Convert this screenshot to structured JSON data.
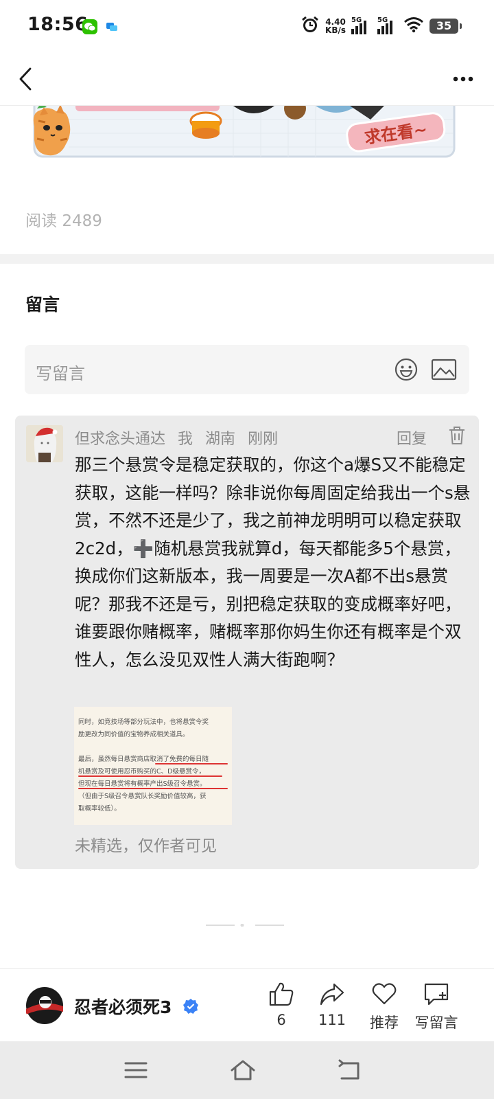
{
  "status_bar": {
    "time": "18:56",
    "net_speed_value": "4.40",
    "net_speed_unit": "KB/s",
    "sim1_label": "5G",
    "sim2_label": "5G",
    "battery_level": "35",
    "icons": [
      "wechat-icon",
      "app-notification-icon",
      "alarm-icon",
      "signal-icon",
      "signal-icon",
      "wifi-icon",
      "battery-icon"
    ]
  },
  "nav": {
    "back_icon": "chevron-left-icon",
    "more_icon": "more-dots-icon"
  },
  "banner": {
    "text": "求在看~"
  },
  "article": {
    "read_label": "阅读",
    "read_count": "2489"
  },
  "comments": {
    "title": "留言",
    "input_placeholder": "写留言",
    "items": [
      {
        "author": "但求念头通达",
        "self_tag": "我",
        "location": "湖南",
        "time": "刚刚",
        "reply_label": "回复",
        "text": "那三个悬赏令是稳定获取的，你这个a爆S又不能稳定获取，这能一样吗？除非说你每周固定给我出一个s悬赏，不然不还是少了，我之前神龙明明可以稳定获取2c2d，➕随机悬赏我就算d，每天都能多5个悬赏，换成你们这新版本，我一周要是一次A都不出s悬赏呢？那我不还是亏，别把稳定获取的变成概率好吧，谁要跟你赌概率，赌概率那你妈生你还有概率是个双性人，怎么没见双性人满大街跑啊？",
        "image_lines": [
          "同时，如竞技场等部分玩法中，也将悬赏令奖",
          "励更改为同价值的宝物养成相关道具。",
          "最后，虽然每日悬赏商店取消了免费的每日随",
          "机悬赏及可使用忍币购买的C、D级悬赏令，",
          "但现在每日悬赏将有概率产出S级召令悬赏。",
          "（但由于S级召令悬赏队长奖励价值较高，获",
          "取概率较低）。"
        ],
        "status_note": "未精选，仅作者可见"
      }
    ]
  },
  "author_bar": {
    "name": "忍者必须死3",
    "like_count": "6",
    "share_count": "111",
    "recommend_label": "推荐",
    "write_comment_label": "写留言"
  },
  "colors": {
    "accent_verified": "#3b82f6",
    "comment_card_bg": "#ebebeb",
    "red_underline": "#dd3333",
    "wechat_green": "#2dc100"
  }
}
